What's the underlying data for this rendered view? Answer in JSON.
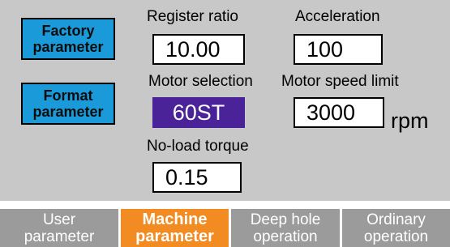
{
  "left_buttons": {
    "factory": {
      "line1": "Factory",
      "line2": "parameter"
    },
    "format": {
      "line1": "Format",
      "line2": "parameter"
    }
  },
  "fields": {
    "register_ratio": {
      "label": "Register ratio",
      "value": "10.00"
    },
    "acceleration": {
      "label": "Acceleration",
      "value": "100"
    },
    "motor_selection": {
      "label": "Motor selection",
      "value": "60ST"
    },
    "motor_speed_limit": {
      "label": "Motor speed limit",
      "value": "3000",
      "unit": "rpm"
    },
    "no_load_torque": {
      "label": "No-load torque",
      "value": "0.15"
    }
  },
  "tabs": [
    {
      "line1": "User",
      "line2": "parameter",
      "active": false
    },
    {
      "line1": "Machine",
      "line2": "parameter",
      "active": true
    },
    {
      "line1": "Deep hole",
      "line2": "operation",
      "active": false
    },
    {
      "line1": "Ordinary",
      "line2": "operation",
      "active": false
    }
  ],
  "colors": {
    "panel_bg": "#c8c8c8",
    "side_button": "#1a9ad9",
    "motor_box": "#4b2398",
    "tab_active": "#f28b22",
    "tab_inactive": "#9b9b9b"
  }
}
